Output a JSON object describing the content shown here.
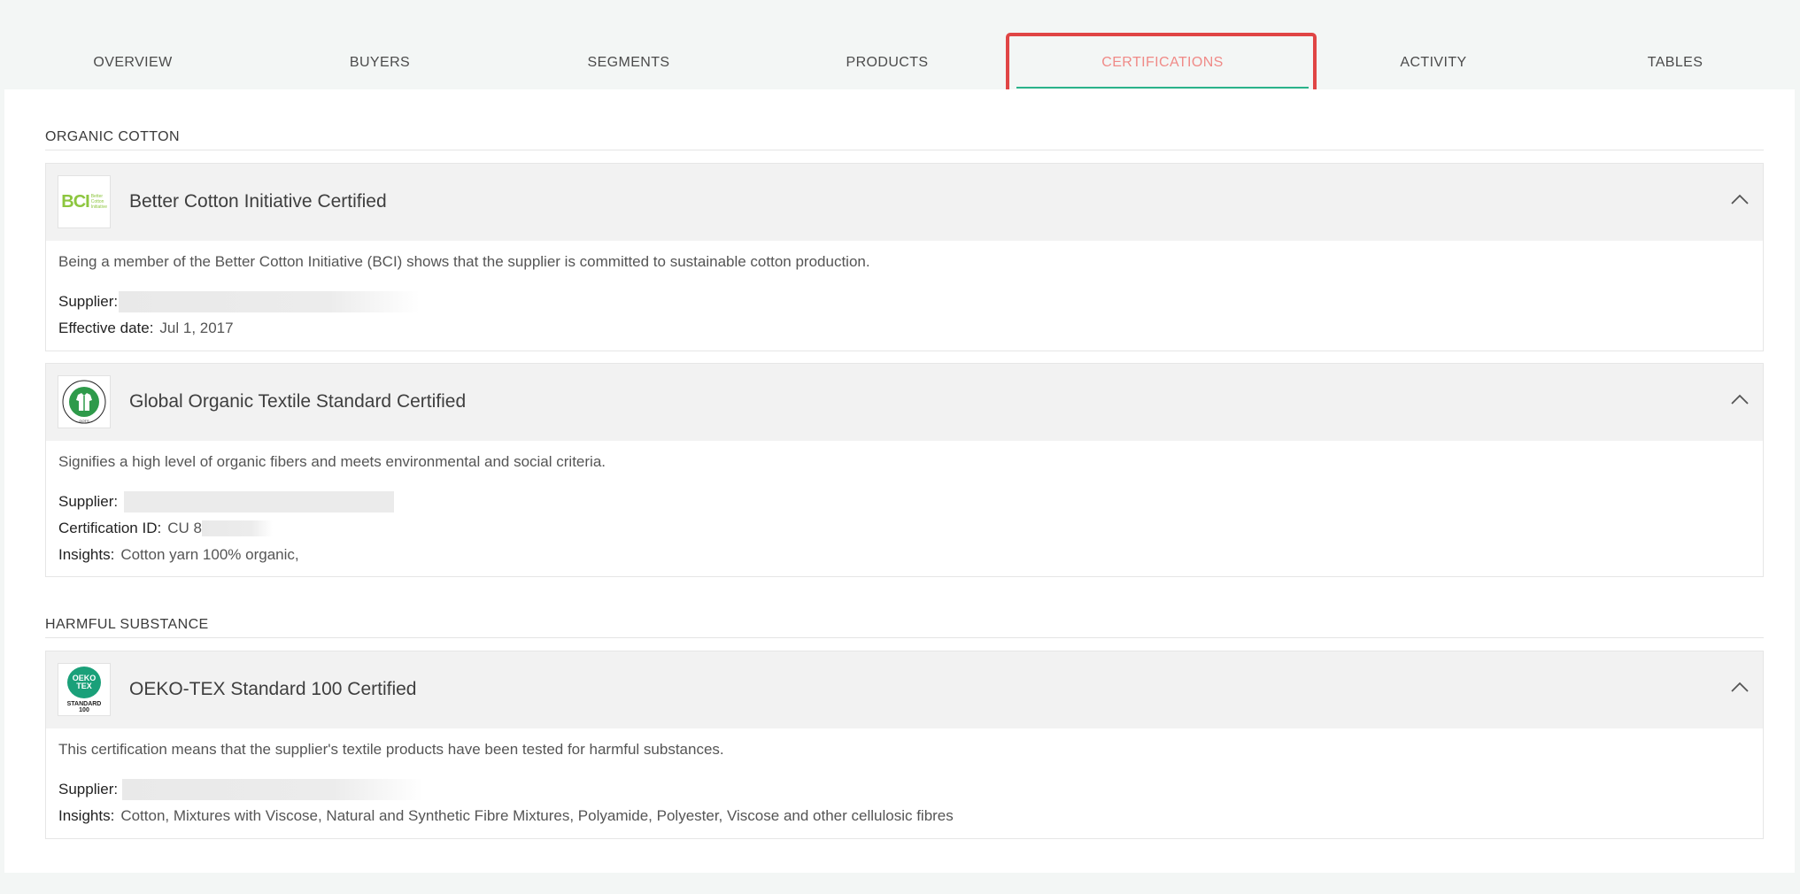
{
  "tabs": [
    {
      "label": "OVERVIEW",
      "active": false
    },
    {
      "label": "BUYERS",
      "active": false
    },
    {
      "label": "SEGMENTS",
      "active": false
    },
    {
      "label": "PRODUCTS",
      "active": false
    },
    {
      "label": "CERTIFICATIONS",
      "active": true
    },
    {
      "label": "ACTIVITY",
      "active": false
    },
    {
      "label": "TABLES",
      "active": false
    }
  ],
  "colors": {
    "active_tab": "#f08a87",
    "underline": "#2ab38a",
    "highlight": "#e04545",
    "bci_green": "#8dc63f",
    "gots_green": "#2e9a4a",
    "oeko_teal": "#1aa079"
  },
  "sections": [
    {
      "title": "ORGANIC COTTON",
      "cards": [
        {
          "icon": "bci-logo",
          "logo_text": "BCI",
          "logo_subtext": "Better Cotton Initiative",
          "title": "Better Cotton Initiative Certified",
          "description": "Being a member of the Better Cotton Initiative (BCI) shows that the supplier is committed to sustainable cotton production.",
          "supplier_label": "Supplier:",
          "effective_label": "Effective date:",
          "effective_value": "Jul 1, 2017"
        },
        {
          "icon": "gots-logo",
          "logo_text": "GLOBAL ORGANIC TEXTILE STANDARD · GOTS",
          "title": "Global Organic Textile Standard Certified",
          "description": "Signifies a high level of organic fibers and meets environmental and social criteria.",
          "supplier_label": "Supplier:",
          "certid_label": "Certification ID:",
          "certid_value": "CU 8",
          "insights_label": "Insights:",
          "insights_value": "Cotton yarn 100% organic,"
        }
      ]
    },
    {
      "title": "HARMFUL SUBSTANCE",
      "cards": [
        {
          "icon": "oeko-tex-logo",
          "logo_text": "OEKO TEX",
          "logo_subtext": "STANDARD 100",
          "title": "OEKO-TEX Standard 100 Certified",
          "description": "This certification means that the supplier's textile products have been tested for harmful substances.",
          "supplier_label": "Supplier:",
          "insights_label": "Insights:",
          "insights_value": "Cotton, Mixtures with Viscose, Natural and Synthetic Fibre Mixtures, Polyamide, Polyester, Viscose and other cellulosic fibres"
        }
      ]
    }
  ]
}
